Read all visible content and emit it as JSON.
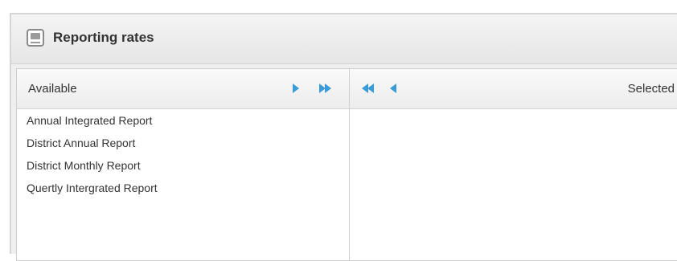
{
  "panel": {
    "title": "Reporting rates",
    "icon": "report-icon"
  },
  "available": {
    "header": "Available",
    "buttons": {
      "move_right": "arrow-right-icon",
      "move_all_right": "double-arrow-right-icon"
    },
    "items": [
      "Annual Integrated Report",
      "District Annual Report",
      "District Monthly Report",
      "Quertly Intergrated Report"
    ]
  },
  "selected": {
    "header": "Selected",
    "buttons": {
      "move_all_left": "double-arrow-left-icon",
      "move_left": "arrow-left-icon"
    },
    "items": []
  },
  "colors": {
    "arrow": "#3a9bd9",
    "border": "#cfcfcf",
    "header_bg": "#e9e9e9"
  }
}
